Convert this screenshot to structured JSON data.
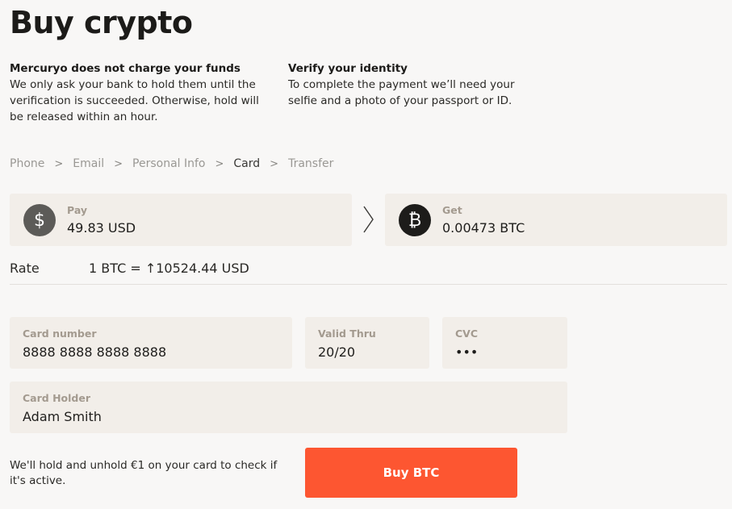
{
  "page": {
    "title": "Buy crypto"
  },
  "info": [
    {
      "heading": "Mercuryo does not charge your funds",
      "text": "We only ask your bank to hold them until the verification is succeeded. Otherwise, hold will be released within an hour."
    },
    {
      "heading": "Verify your identity",
      "text": "To complete the payment we’ll need your selfie and a photo of your passport or ID."
    }
  ],
  "breadcrumb": {
    "steps": [
      "Phone",
      "Email",
      "Personal Info",
      "Card",
      "Transfer"
    ],
    "active": "Card"
  },
  "exchange": {
    "pay": {
      "label": "Pay",
      "value": "49.83 USD",
      "icon": "dollar-icon"
    },
    "get": {
      "label": "Get",
      "value": "0.00473 BTC",
      "icon": "bitcoin-icon"
    }
  },
  "rate": {
    "label": "Rate",
    "value": "1 BTC =  ↑10524.44 USD"
  },
  "form": {
    "card_number": {
      "label": "Card number",
      "value": "8888 8888 8888 8888"
    },
    "valid_thru": {
      "label": "Valid Thru",
      "value": "20/20"
    },
    "cvc": {
      "label": "CVC",
      "value": "•••"
    },
    "card_holder": {
      "label": "Card Holder",
      "value": "Adam Smith"
    }
  },
  "note": "We'll hold and unhold €1 on your card to check if it's active.",
  "buy_button": {
    "label": "Buy BTC",
    "color": "#fd5631"
  }
}
